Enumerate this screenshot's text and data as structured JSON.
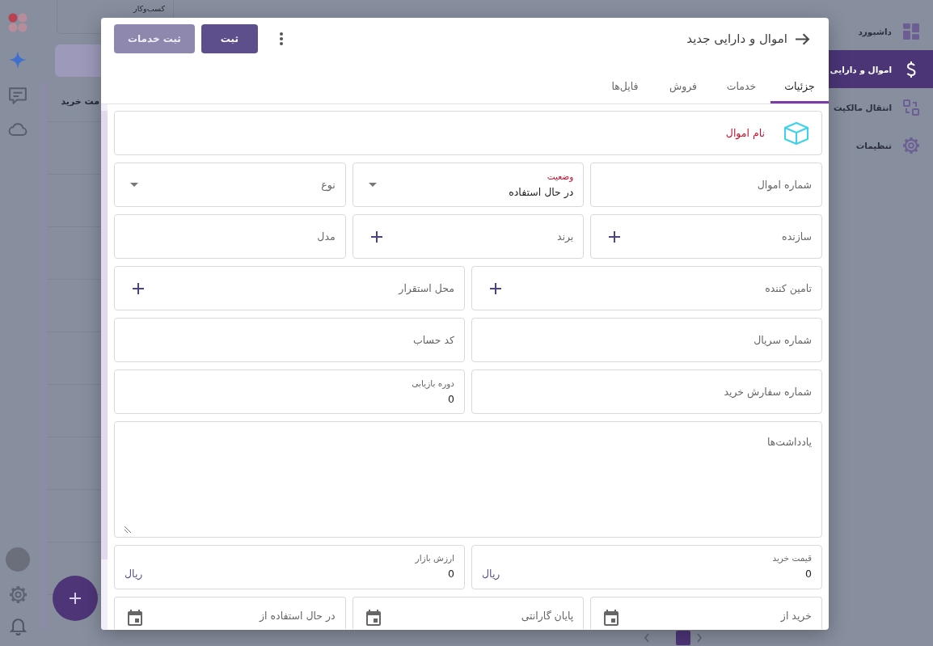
{
  "workspace": {
    "card_title": "کسب‌وکار",
    "table": {
      "columns": [
        "مت خرید"
      ]
    }
  },
  "sidebar": {
    "items": [
      {
        "label": "داشبورد",
        "selected": false
      },
      {
        "label": "اموال و دارایی",
        "selected": true
      },
      {
        "label": "انتقال مالکیت",
        "selected": false
      },
      {
        "label": "تنظیمات",
        "selected": false
      }
    ]
  },
  "dialog": {
    "title": "اموال و دارایی جدید",
    "buttons": [
      {
        "label": "ثبت",
        "disabled": false
      },
      {
        "label": "ثبت خدمات",
        "disabled": true
      }
    ],
    "tabs": [
      {
        "label": "جزئیات",
        "selected": true
      },
      {
        "label": "خدمات",
        "selected": false
      },
      {
        "label": "فروش",
        "selected": false
      },
      {
        "label": "فایل‌ها",
        "selected": false
      }
    ],
    "form": {
      "rows": [
        [
          {
            "kind": "title",
            "label": "نام اموال",
            "required": true
          }
        ],
        [
          {
            "kind": "text",
            "label": "شماره اموال",
            "required": false
          },
          {
            "kind": "select",
            "label": "وضعیت",
            "value": "در حال استفاده",
            "required": true
          },
          {
            "kind": "select",
            "label": "نوع",
            "required": false
          }
        ],
        [
          {
            "kind": "lookup",
            "label": "سازنده",
            "required": false
          },
          {
            "kind": "lookup",
            "label": "برند",
            "required": false
          },
          {
            "kind": "text",
            "label": "مدل",
            "required": false
          }
        ],
        [
          {
            "kind": "lookup",
            "label": "تامین کننده",
            "required": false
          },
          {
            "kind": "lookup",
            "label": "محل استقرار",
            "required": false
          }
        ],
        [
          {
            "kind": "text",
            "label": "شماره سریال",
            "required": false
          },
          {
            "kind": "text",
            "label": "کد حساب",
            "required": false
          }
        ],
        [
          {
            "kind": "text",
            "label": "شماره سفارش خرید",
            "required": false
          },
          {
            "kind": "text",
            "label": "دوره بازیابی",
            "value": "0",
            "required": false
          }
        ],
        [
          {
            "kind": "textarea",
            "label": "یادداشت‌ها",
            "required": false
          }
        ],
        [
          {
            "kind": "currency",
            "label": "قیمت خرید",
            "value": "0",
            "suffix": "ریال",
            "required": false
          },
          {
            "kind": "currency",
            "label": "ارزش بازار",
            "value": "0",
            "suffix": "ریال",
            "required": false
          }
        ],
        [
          {
            "kind": "date",
            "label": "خرید از",
            "required": false
          },
          {
            "kind": "date",
            "label": "پایان گارانتی",
            "required": false
          },
          {
            "kind": "date",
            "label": "در حال استفاده از",
            "required": false
          }
        ]
      ]
    }
  }
}
